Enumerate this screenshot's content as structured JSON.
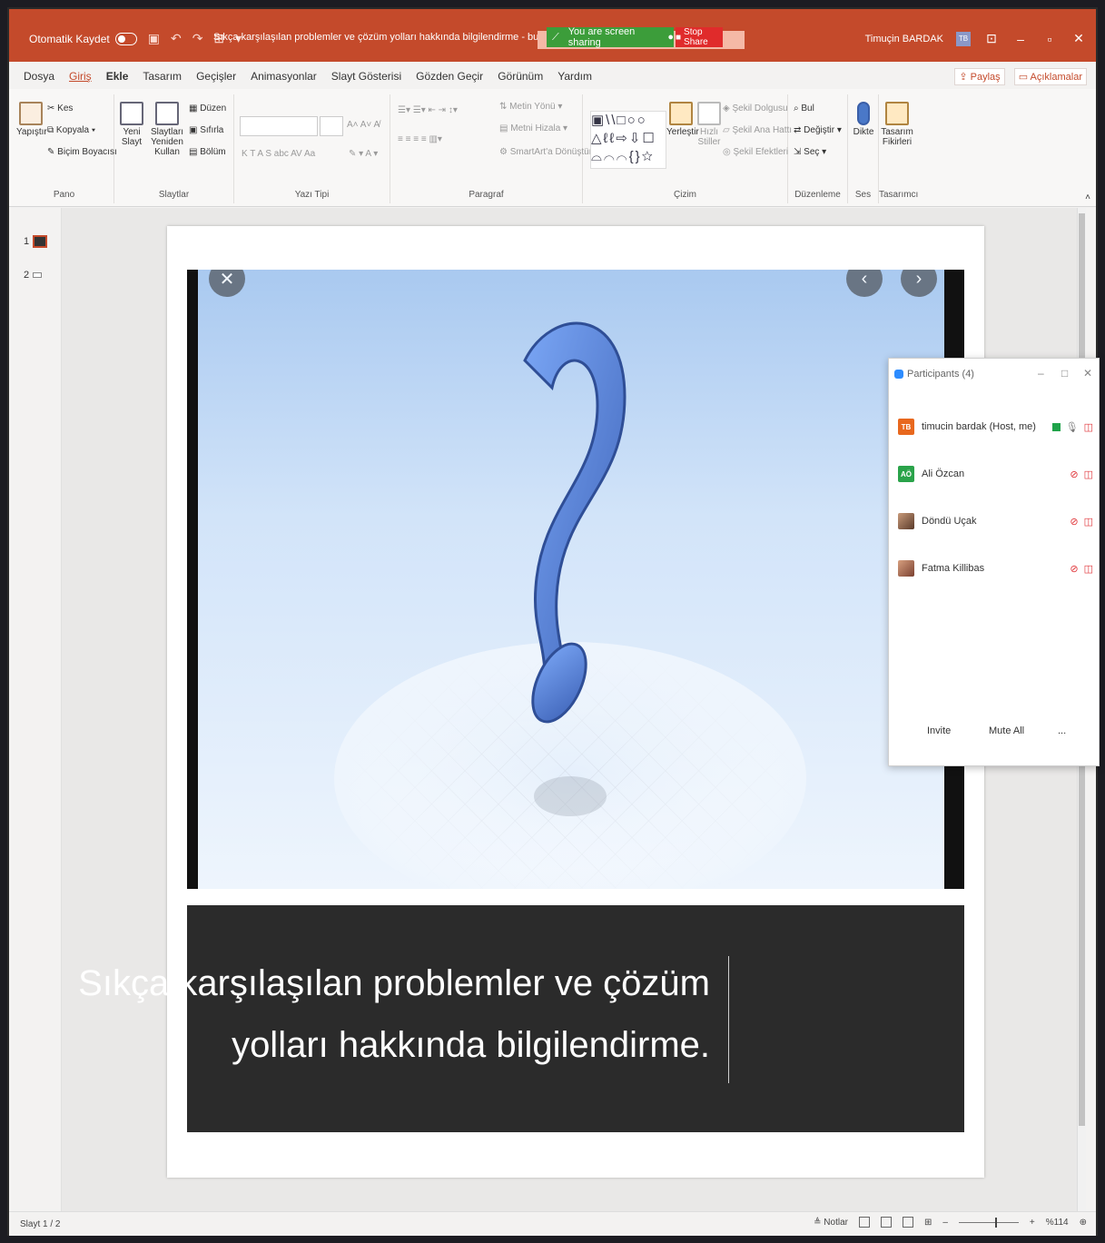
{
  "titlebar": {
    "autosave_label": "Otomatik Kaydet",
    "doc_title": "Sıkça karşılaşılan problemler ve çözüm yolları hakkında bilgilendirme - bu bilgisayar konumuna kaydedildi",
    "sharing_text": "You are screen sharing",
    "stop_share_label": "Stop Share",
    "user_name": "Timuçin BARDAK",
    "user_initials": "TB"
  },
  "menu": {
    "tabs": [
      "Dosya",
      "Giriş",
      "Ekle",
      "Tasarım",
      "Geçişler",
      "Animasyonlar",
      "Slayt Gösterisi",
      "Gözden Geçir",
      "Görünüm",
      "Yardım"
    ],
    "share_label": "Paylaş",
    "comments_label": "Açıklamalar"
  },
  "ribbon": {
    "pano": {
      "label": "Pano",
      "paste": "Yapıştır",
      "cut": "Kes",
      "copy": "Kopyala",
      "format_painter": "Biçim Boyacısı"
    },
    "slaytlar": {
      "label": "Slaytlar",
      "new_slide": "Yeni Slayt",
      "reuse": "Slaytları Yeniden Kullan",
      "layout": "Düzen",
      "reset": "Sıfırla",
      "section": "Bölüm"
    },
    "yazi_tipi": {
      "label": "Yazı Tipi",
      "format_row": "K  T  A  S  abc  AV  Aa"
    },
    "paragraf": {
      "label": "Paragraf",
      "text_direction": "Metin Yönü",
      "align_text": "Metni Hizala",
      "smartart": "SmartArt'a Dönüştür"
    },
    "cizim": {
      "label": "Çizim",
      "arrange": "Yerleştir",
      "quick_styles": "Hızlı Stiller",
      "fill": "Şekil Dolgusu",
      "outline": "Şekil Ana Hattı",
      "effects": "Şekil Efektleri"
    },
    "duzenleme": {
      "label": "Düzenleme",
      "find": "Bul",
      "replace": "Değiştir",
      "select": "Seç"
    },
    "ses": {
      "label": "Ses",
      "dictate": "Dikte"
    },
    "tasarimci": {
      "label": "Tasarımcı",
      "ideas": "Tasarım Fikirleri"
    }
  },
  "thumbs": {
    "slide1": "1",
    "slide2": "2"
  },
  "slide": {
    "caption_line1": "Sıkça karşılaşılan problemler ve çözüm",
    "caption_line2": "yolları hakkında bilgilendirme.",
    "photo_glyph": "?"
  },
  "participants": {
    "title": "Participants (4)",
    "rows": [
      {
        "initials": "TB",
        "name": "timucin bardak (Host, me)",
        "color": "#e8681e"
      },
      {
        "initials": "AÖ",
        "name": "Ali Özcan",
        "color": "#2aa34a"
      },
      {
        "initials": "",
        "name": "Döndü Uçak",
        "color": ""
      },
      {
        "initials": "",
        "name": "Fatma Killibas",
        "color": ""
      }
    ],
    "invite_label": "Invite",
    "mute_all_label": "Mute All",
    "more_label": "..."
  },
  "status": {
    "slide_count": "Slayt 1 / 2",
    "notes_label": "Notlar",
    "zoom": "%114"
  }
}
